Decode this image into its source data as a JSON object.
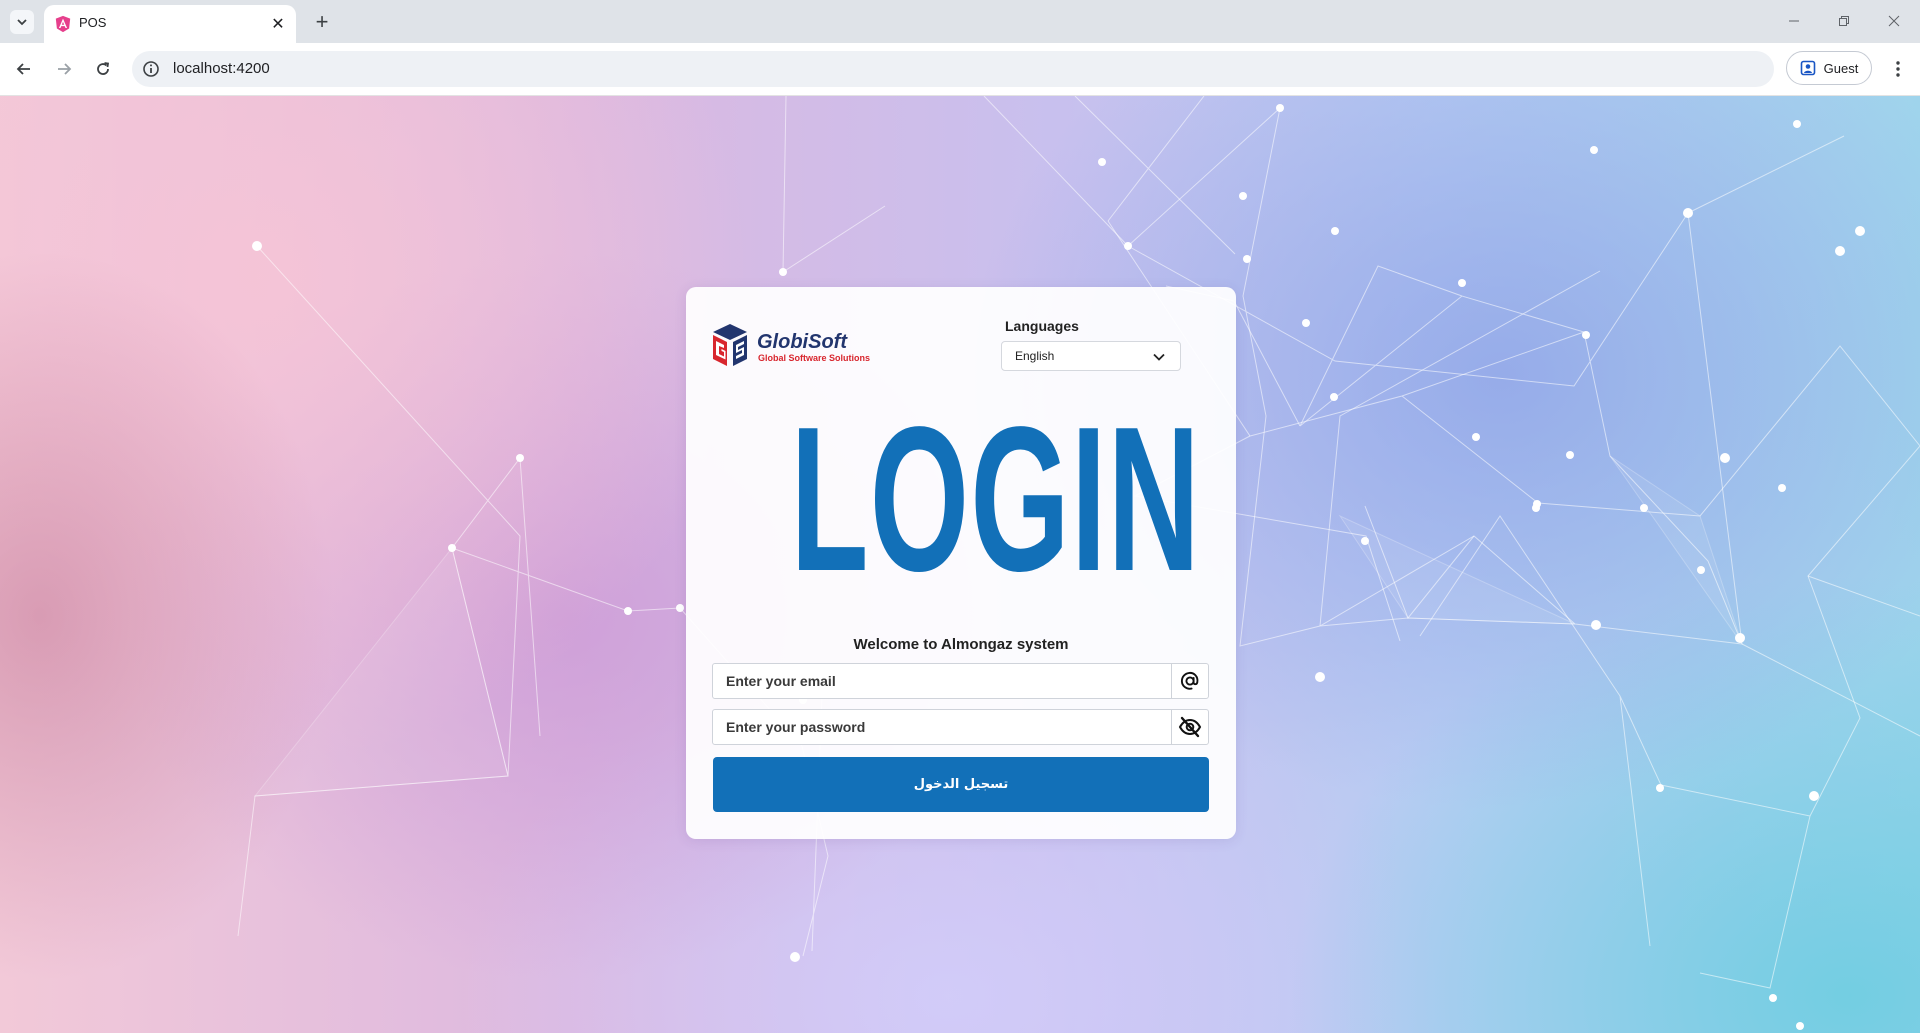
{
  "browser": {
    "tab": {
      "title": "POS"
    },
    "address_bar": {
      "url": "localhost:4200"
    },
    "profile": {
      "label": "Guest"
    }
  },
  "login_card": {
    "logo": {
      "brand": "GlobiSoft",
      "tagline": "Global Software Solutions"
    },
    "language": {
      "label": "Languages",
      "selected": "English"
    },
    "title": "LOGIN",
    "welcome": "Welcome to Almongaz system",
    "email": {
      "placeholder": "Enter your email",
      "value": ""
    },
    "password": {
      "placeholder": "Enter your password",
      "value": ""
    },
    "submit_label": "تسجيل الدخول"
  },
  "colors": {
    "primary": "#1270b8",
    "logo_navy": "#22356e",
    "logo_red": "#d8262e"
  }
}
